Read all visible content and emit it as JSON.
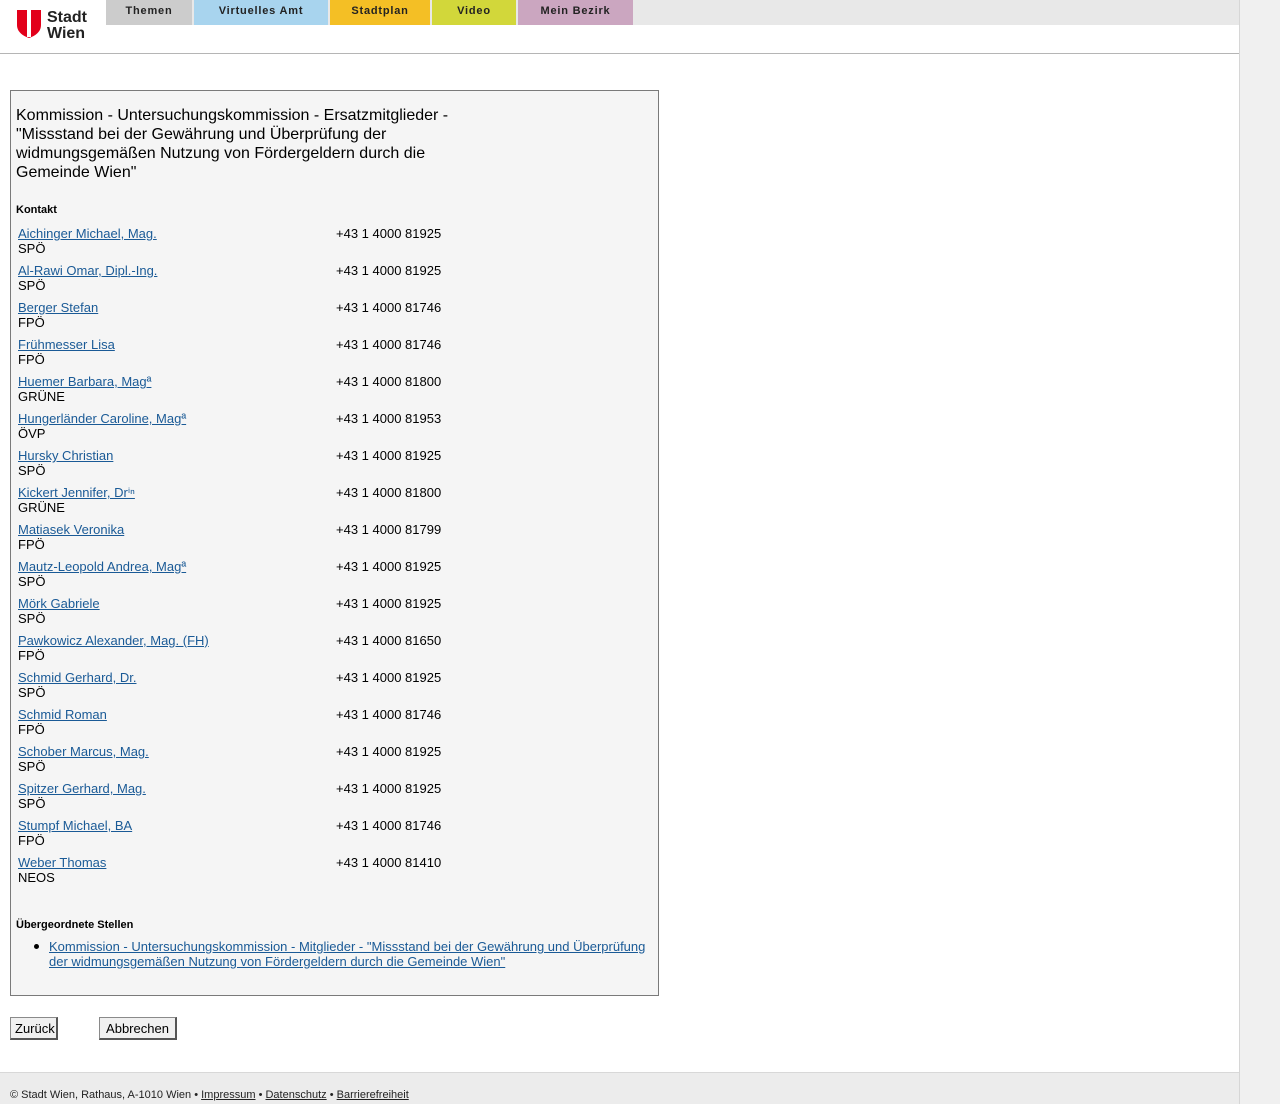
{
  "header": {
    "logo_line1": "Stadt",
    "logo_line2": "Wien",
    "nav": [
      {
        "label": "Themen",
        "color": "#cccccc"
      },
      {
        "label": "Virtuelles Amt",
        "color": "#a8d4ee"
      },
      {
        "label": "Stadtplan",
        "color": "#f4bf25"
      },
      {
        "label": "Video",
        "color": "#d2d73a"
      },
      {
        "label": "Mein Bezirk",
        "color": "#cba6c0"
      }
    ]
  },
  "panel": {
    "title": "Kommission - Untersuchungskommission - Ersatzmitglieder - \"Missstand bei der Gewährung und Überprüfung der widmungsgemäßen Nutzung von Fördergeldern durch die Gemeinde Wien\"",
    "contact_heading": "Kontakt",
    "contacts": [
      {
        "name": "Aichinger Michael, Mag.",
        "party": "SPÖ",
        "phone": "+43 1 4000 81925"
      },
      {
        "name": "Al-Rawi Omar, Dipl.-Ing.",
        "party": "SPÖ",
        "phone": "+43 1 4000 81925"
      },
      {
        "name": "Berger Stefan",
        "party": "FPÖ",
        "phone": "+43 1 4000 81746"
      },
      {
        "name": "Frühmesser Lisa",
        "party": "FPÖ",
        "phone": "+43 1 4000 81746"
      },
      {
        "name": "Huemer Barbara, Magª",
        "party": "GRÜNE",
        "phone": "+43 1 4000 81800"
      },
      {
        "name": "Hungerländer Caroline, Magª",
        "party": "ÖVP",
        "phone": "+43 1 4000 81953"
      },
      {
        "name": "Hursky Christian",
        "party": "SPÖ",
        "phone": "+43 1 4000 81925"
      },
      {
        "name": "Kickert Jennifer, Drⁱⁿ",
        "party": "GRÜNE",
        "phone": "+43 1 4000 81800"
      },
      {
        "name": "Matiasek Veronika",
        "party": "FPÖ",
        "phone": "+43 1 4000 81799"
      },
      {
        "name": "Mautz-Leopold Andrea, Magª",
        "party": "SPÖ",
        "phone": "+43 1 4000 81925"
      },
      {
        "name": "Mörk Gabriele",
        "party": "SPÖ",
        "phone": "+43 1 4000 81925"
      },
      {
        "name": "Pawkowicz Alexander, Mag. (FH)",
        "party": "FPÖ",
        "phone": "+43 1 4000 81650"
      },
      {
        "name": "Schmid Gerhard, Dr.",
        "party": "SPÖ",
        "phone": "+43 1 4000 81925"
      },
      {
        "name": "Schmid Roman",
        "party": "FPÖ",
        "phone": "+43 1 4000 81746"
      },
      {
        "name": "Schober Marcus, Mag.",
        "party": "SPÖ",
        "phone": "+43 1 4000 81925"
      },
      {
        "name": "Spitzer Gerhard, Mag.",
        "party": "SPÖ",
        "phone": "+43 1 4000 81925"
      },
      {
        "name": "Stumpf Michael, BA",
        "party": "FPÖ",
        "phone": "+43 1 4000 81746"
      },
      {
        "name": "Weber Thomas",
        "party": "NEOS",
        "phone": "+43 1 4000 81410"
      }
    ],
    "parent_heading": "Übergeordnete Stellen",
    "parent_links": [
      "Kommission - Untersuchungskommission - Mitglieder - \"Missstand bei der Gewährung und Überprüfung der widmungsgemäßen Nutzung von Fördergeldern durch die Gemeinde Wien\""
    ]
  },
  "buttons": {
    "back_label": "Zurück",
    "cancel_label": "Abbrechen"
  },
  "footer": {
    "copyright": "© Stadt Wien, Rathaus, A-1010 Wien",
    "separator": " • ",
    "links": [
      "Impressum",
      "Datenschutz",
      "Barrierefreiheit"
    ]
  }
}
